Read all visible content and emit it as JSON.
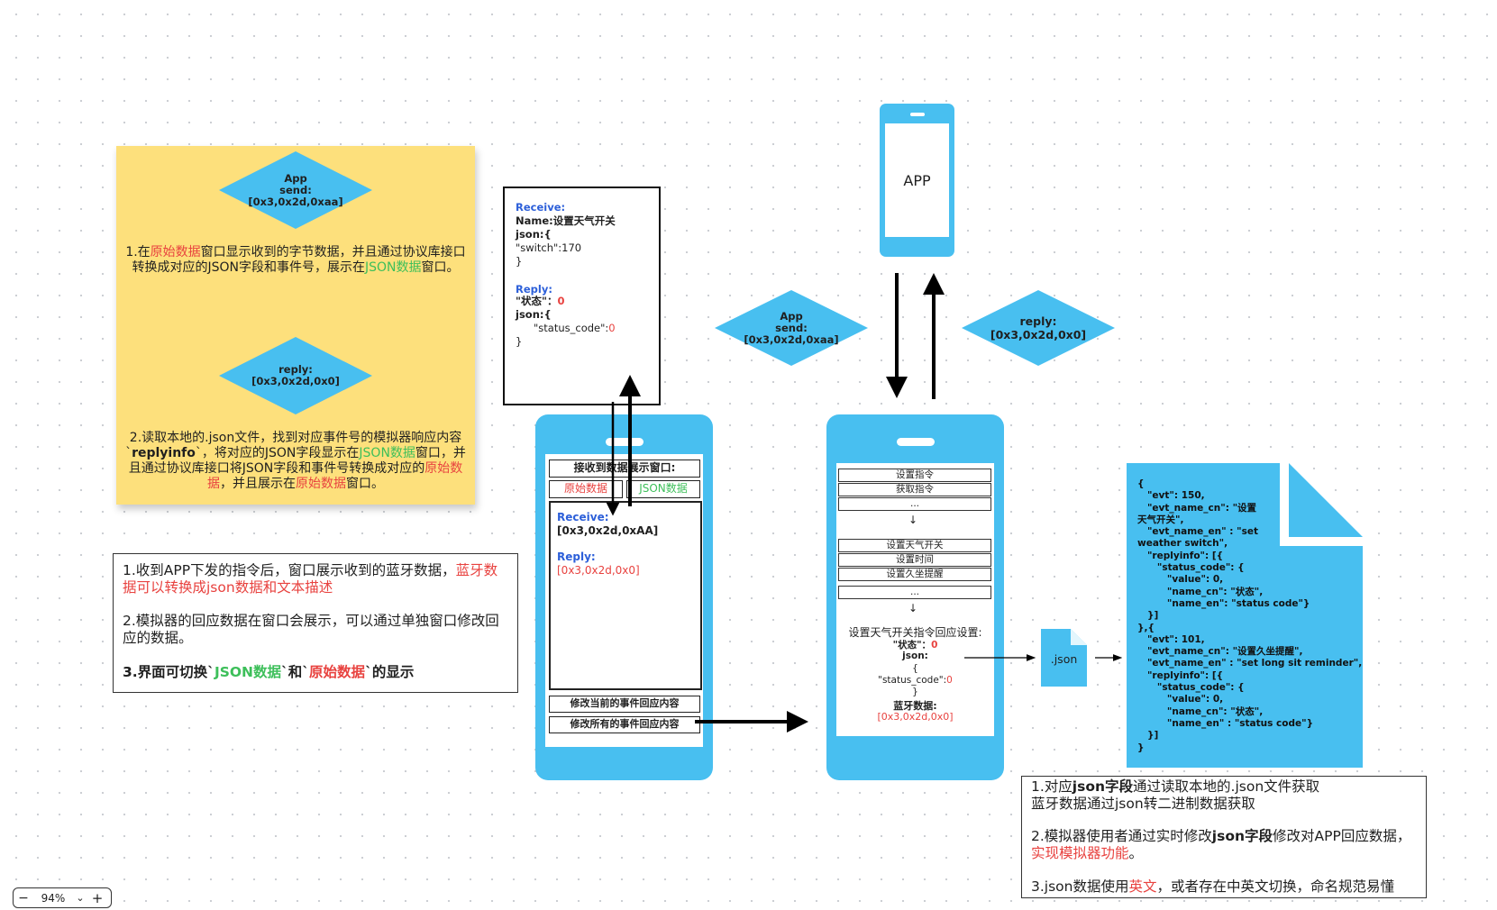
{
  "sticky": {
    "diamond1": {
      "line1": "App",
      "line2": "send:",
      "line3": "[0x3,0x2d,0xaa]"
    },
    "para1": {
      "a": "1.在",
      "b": "原始数据",
      "c": "窗口显示收到的字节数据，并且通过协议库接口转换成对应的JSON字段和事件号，展示在",
      "d": "JSON数据",
      "e": "窗口。"
    },
    "diamond2": {
      "line1": "reply:",
      "line2": "[0x3,0x2d,0x0]"
    },
    "para2": {
      "a": "2.读取本地的.json文件，找到对应事件号的模拟器响应内容`",
      "b": "replyinfo",
      "c": "`，将对应的JSON字段显示在",
      "d": "JSON数据",
      "e": "窗口，并且通过协议库接口将JSON字段和事件号转换成对应的",
      "f": "原始数据",
      "g": "，并且展示在",
      "h": "原始数据",
      "i": "窗口。"
    }
  },
  "note_left": {
    "p1a": "1.收到APP下发的指令后，窗口展示收到的蓝牙数据，",
    "p1b": "蓝牙数据可以转换成json数据和文本描述",
    "p2": "2.模拟器的回应数据在窗口会展示，可以通过单独窗口修改回应的数据。",
    "p3a": "3.界面可切换`",
    "p3b": "JSON数据",
    "p3c": "`和`",
    "p3d": "原始数据",
    "p3e": "`的显示"
  },
  "receive_box": {
    "receive_label": "Receive:",
    "name_line": "Name:设置天气开关",
    "json_open": "json:{",
    "switch_line": "\"switch\":170",
    "close1": "}",
    "reply_label": "Reply:",
    "status_label": "\"状态\"：",
    "status_value": "0",
    "json_open2": "json:{",
    "status_code_label": "\"status_code\":",
    "status_code_value": "0",
    "close2": "}"
  },
  "phone1": {
    "title": "接收到数据展示窗口:",
    "tab_raw": "原始数据",
    "tab_json": "JSON数据",
    "receive_label": "Receive:",
    "receive_value": "[0x3,0x2d,0xAA]",
    "reply_label": "Reply:",
    "reply_value": "[0x3,0x2d,0x0]",
    "button1": "修改当前的事件回应内容",
    "button2": "修改所有的事件回应内容"
  },
  "app_phone": {
    "label": "APP"
  },
  "diamond_send": {
    "line1": "App",
    "line2": "send:",
    "line3": "[0x3,0x2d,0xaa]"
  },
  "diamond_reply": {
    "line1": "reply:",
    "line2": "[0x3,0x2d,0x0]"
  },
  "phone2": {
    "items_top": [
      "设置指令",
      "获取指令",
      "..."
    ],
    "down_arrow": "↓",
    "items_mid": [
      "设置天气开关",
      "设置时间",
      "设置久坐提醒"
    ],
    "item_more": "...",
    "reply_title": "设置天气开关指令回应设置:",
    "status_label": "\"状态\"：",
    "status_value": "0",
    "json_label": "json:",
    "brace_open": "{",
    "status_code_label": "\"status_code\":",
    "status_code_value": "0",
    "brace_close": "}",
    "bt_label": "蓝牙数据:",
    "bt_value": "[0x3,0x2d,0x0]"
  },
  "json_file": {
    "label": ".json"
  },
  "json_doc": {
    "text": "{\n   \"evt\": 150,\n   \"evt_name_cn\": \"设置\n天气开关\",\n   \"evt_name_en\" : \"set\nweather switch\",\n   \"replyinfo\": [{\n      \"status_code\": {\n         \"value\": 0,\n         \"name_cn\": \"状态\",\n         \"name_en\": \"status code\"}\n   }]\n},{\n   \"evt\": 101,\n   \"evt_name_cn\": \"设置久坐提醒\",\n   \"evt_name_en\" : \"set long sit reminder\",\n   \"replyinfo\": [{\n      \"status_code\": {\n         \"value\": 0,\n         \"name_cn\": \"状态\",\n         \"name_en\" : \"status code\"}\n   }]\n}"
  },
  "note_right": {
    "p1a": "1.对应",
    "p1b": "json字段",
    "p1c": "通过读取本地的.json文件获取",
    "p1d": "蓝牙数据通过json转二进制数据获取",
    "p2a": "2.模拟器使用者通过实时修改",
    "p2b": "json字段",
    "p2c": "修改对APP回应数据，",
    "p2d": "实现模拟器功能",
    "p2e": "。",
    "p3a": "3.json数据使用",
    "p3b": "英文",
    "p3c": "，或者存在中英文切换，命名规范易懂"
  },
  "zoom": {
    "minus": "−",
    "level": "94%",
    "chevron": "⌄",
    "plus": "+"
  },
  "colors": {
    "phone_blue": "#48bff0",
    "sticky_yellow": "#fde07c",
    "red": "#e8423f",
    "green": "#3dbf5a",
    "blue": "#2c5fd9"
  }
}
